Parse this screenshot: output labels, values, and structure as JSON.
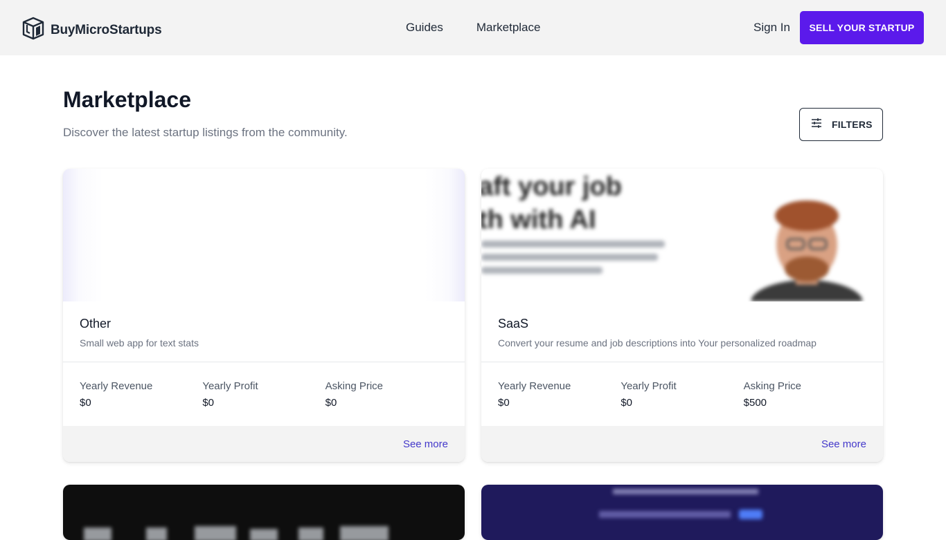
{
  "header": {
    "brand": "BuyMicroStartups",
    "nav": [
      "Guides",
      "Marketplace"
    ],
    "sign_in": "Sign In",
    "sell_button": "SELL YOUR STARTUP"
  },
  "page": {
    "title": "Marketplace",
    "subtitle": "Discover the latest startup listings from the community.",
    "filters_label": "FILTERS"
  },
  "listings": [
    {
      "category": "Other",
      "description": "Small web app for text stats",
      "stats": [
        {
          "label": "Yearly Revenue",
          "value": "$0"
        },
        {
          "label": "Yearly Profit",
          "value": "$0"
        },
        {
          "label": "Asking Price",
          "value": "$0"
        }
      ],
      "see_more": "See more"
    },
    {
      "category": "SaaS",
      "description": "Convert your resume and job descriptions into Your personalized roadmap",
      "thumb_heading": [
        "aft your job",
        "th with AI"
      ],
      "stats": [
        {
          "label": "Yearly Revenue",
          "value": "$0"
        },
        {
          "label": "Yearly Profit",
          "value": "$0"
        },
        {
          "label": "Asking Price",
          "value": "$500"
        }
      ],
      "see_more": "See more"
    }
  ],
  "colors": {
    "accent": "#5b1aeb",
    "link": "#4338ca",
    "header_bg": "#f3f3f3"
  },
  "icons": {
    "logo": "cube-logo-icon",
    "filters": "sliders-icon"
  }
}
